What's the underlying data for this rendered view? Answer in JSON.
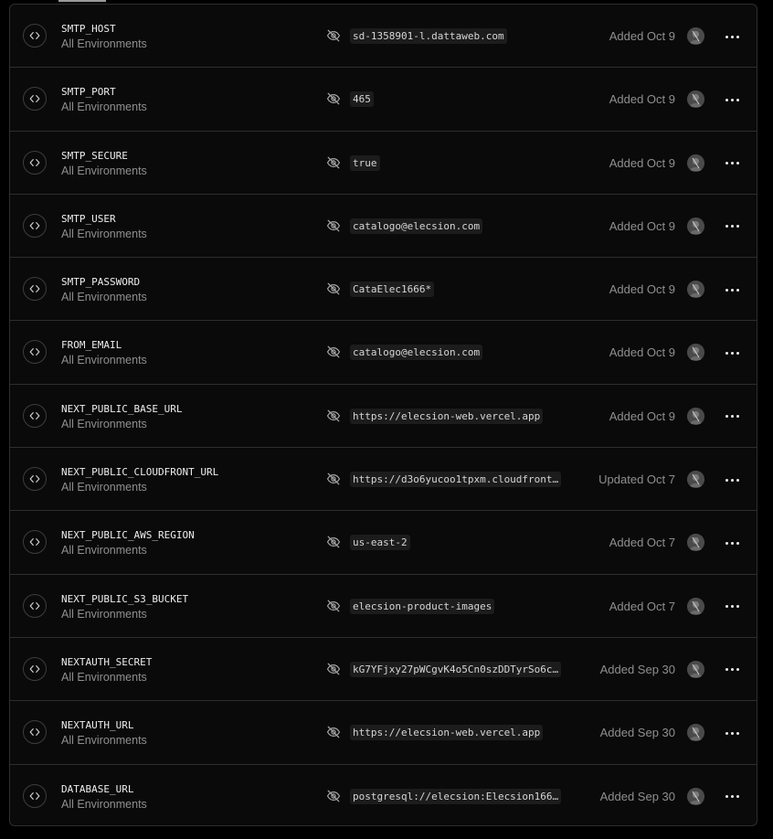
{
  "variables": [
    {
      "key": "SMTP_HOST",
      "environment": "All Environments",
      "value": "sd-1358901-l.dattaweb.com",
      "status": "Added Oct 9",
      "icon": "code-icon",
      "visibility_icon": "eye-off-icon"
    },
    {
      "key": "SMTP_PORT",
      "environment": "All Environments",
      "value": "465",
      "status": "Added Oct 9",
      "icon": "code-icon",
      "visibility_icon": "eye-off-icon"
    },
    {
      "key": "SMTP_SECURE",
      "environment": "All Environments",
      "value": "true",
      "status": "Added Oct 9",
      "icon": "code-icon",
      "visibility_icon": "eye-off-icon"
    },
    {
      "key": "SMTP_USER",
      "environment": "All Environments",
      "value": "catalogo@elecsion.com",
      "status": "Added Oct 9",
      "icon": "code-icon",
      "visibility_icon": "eye-off-icon"
    },
    {
      "key": "SMTP_PASSWORD",
      "environment": "All Environments",
      "value": "CataElec1666*",
      "status": "Added Oct 9",
      "icon": "code-icon",
      "visibility_icon": "eye-off-icon"
    },
    {
      "key": "FROM_EMAIL",
      "environment": "All Environments",
      "value": "catalogo@elecsion.com",
      "status": "Added Oct 9",
      "icon": "code-icon",
      "visibility_icon": "eye-off-icon"
    },
    {
      "key": "NEXT_PUBLIC_BASE_URL",
      "environment": "All Environments",
      "value": "https://elecsion-web.vercel.app",
      "status": "Added Oct 9",
      "icon": "code-icon",
      "visibility_icon": "eye-off-icon"
    },
    {
      "key": "NEXT_PUBLIC_CLOUDFRONT_URL",
      "environment": "All Environments",
      "value": "https://d3o6yucoo1tpxm.cloudfront…",
      "status": "Updated Oct 7",
      "icon": "code-icon",
      "visibility_icon": "eye-off-icon"
    },
    {
      "key": "NEXT_PUBLIC_AWS_REGION",
      "environment": "All Environments",
      "value": "us-east-2",
      "status": "Added Oct 7",
      "icon": "code-icon",
      "visibility_icon": "eye-off-icon"
    },
    {
      "key": "NEXT_PUBLIC_S3_BUCKET",
      "environment": "All Environments",
      "value": "elecsion-product-images",
      "status": "Added Oct 7",
      "icon": "code-icon",
      "visibility_icon": "eye-off-icon"
    },
    {
      "key": "NEXTAUTH_SECRET",
      "environment": "All Environments",
      "value": "kG7YFjxy27pWCgvK4o5Cn0szDDTyrSo6c…",
      "status": "Added Sep 30",
      "icon": "code-icon",
      "visibility_icon": "eye-off-icon"
    },
    {
      "key": "NEXTAUTH_URL",
      "environment": "All Environments",
      "value": "https://elecsion-web.vercel.app",
      "status": "Added Sep 30",
      "icon": "code-icon",
      "visibility_icon": "eye-off-icon"
    },
    {
      "key": "DATABASE_URL",
      "environment": "All Environments",
      "value": "postgresql://elecsion:Elecsion166…",
      "status": "Added Sep 30",
      "icon": "code-icon",
      "visibility_icon": "eye-off-icon"
    }
  ],
  "colors": {
    "background": "#000000",
    "panel": "#0a0a0a",
    "border": "#2e2e2e",
    "text_primary": "#ededed",
    "text_secondary": "#8f8f8f",
    "chip_background": "#1c1c1c"
  }
}
